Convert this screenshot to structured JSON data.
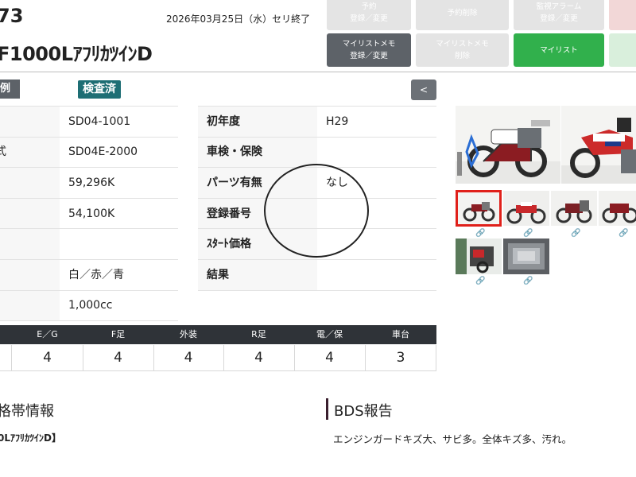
{
  "header": {
    "lot_no": "73",
    "model": "F1000LｱﾌﾘｶﾂｲﾝD",
    "auction_end": "2026年03月25日（水）セリ終了"
  },
  "buttons": {
    "reserve": [
      "予約",
      "登録／変更"
    ],
    "reserve_delete": "予約削除",
    "watch_alarm": [
      "監視アラーム",
      "登録／変更"
    ],
    "mylist_memo": [
      "マイリストメモ",
      "登録／変更"
    ],
    "mylist_memo_delete": [
      "マイリストメモ",
      "削除"
    ],
    "mylist": "マイリスト"
  },
  "tags": {
    "left_tag": "例",
    "inspected": "検査済",
    "back": "<"
  },
  "details_left": [
    {
      "label": "",
      "value": "SD04-1001"
    },
    {
      "label": "式",
      "value": "SD04E-2000"
    },
    {
      "label": "",
      "value": "59,296K"
    },
    {
      "label": "",
      "value": "54,100K"
    },
    {
      "label": "",
      "value": ""
    },
    {
      "label": "",
      "value": "白／赤／青"
    },
    {
      "label": "",
      "value": "1,000cc"
    }
  ],
  "details_right": [
    {
      "label": "初年度",
      "value": "H29"
    },
    {
      "label": "車検・保険",
      "value": ""
    },
    {
      "label": "パーツ有無",
      "value": "なし"
    },
    {
      "label": "登録番号",
      "value": ""
    },
    {
      "label": "ｽﾀｰﾄ価格",
      "value": ""
    },
    {
      "label": "結果",
      "value": ""
    }
  ],
  "grades": {
    "headers": [
      "E／G",
      "F足",
      "外装",
      "R足",
      "電／保",
      "車台"
    ],
    "values": [
      "4",
      "4",
      "4",
      "4",
      "4",
      "3"
    ]
  },
  "price_section": {
    "title": "格帯情報",
    "model_line": "0LｱﾌﾘｶﾂｲﾝD】"
  },
  "bds": {
    "title": "BDS報告",
    "report": "エンジンガードキズ大、サビ多。全体キズ多、汚れ。"
  },
  "colors": {
    "dark_tag": "#5d6268",
    "inspected_tag": "#1e6e74",
    "mylist_green": "#31b04c",
    "grade_header": "#2f3338",
    "selected_thumb_border": "#e0201a"
  },
  "icons": {
    "photo_link": "link-icon"
  }
}
